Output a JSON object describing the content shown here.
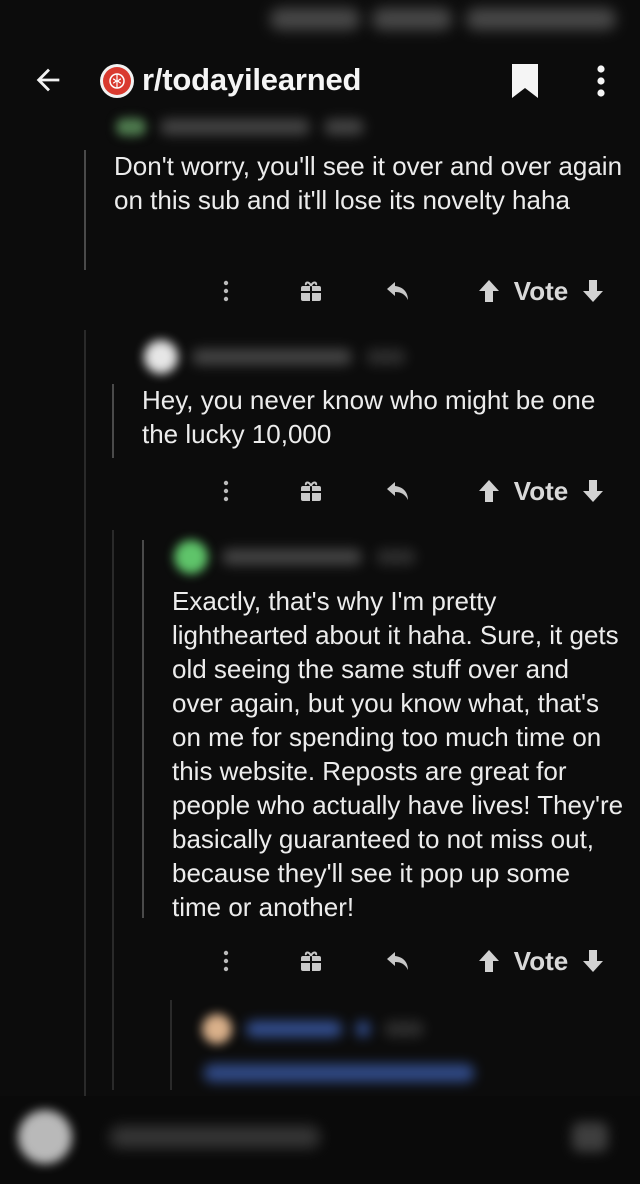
{
  "header": {
    "subreddit": "r/todayilearned",
    "back_icon": "arrow-left-icon",
    "bookmark_icon": "bookmark-icon",
    "more_icon": "more-vertical-icon"
  },
  "comments": [
    {
      "body": "Don't worry, you'll see it over and over again on this sub and it'll lose its novelty haha",
      "vote_label": "Vote"
    },
    {
      "body": "Hey, you never know who might be one the lucky 10,000",
      "vote_label": "Vote"
    },
    {
      "body": "Exactly, that's why I'm pretty lighthearted about it haha. Sure, it gets old seeing the same stuff over and over again, but you know what, that's on me for spending too much time on this website. Reposts are great for people who actually have lives! They're basically guaranteed to not miss out, because they'll see it pop up some time or another!",
      "vote_label": "Vote"
    }
  ],
  "colors": {
    "background": "#0c0c0c",
    "text": "#ececec",
    "subreddit_icon": "#d93a2f",
    "thread_line": "#4a4a4a"
  }
}
